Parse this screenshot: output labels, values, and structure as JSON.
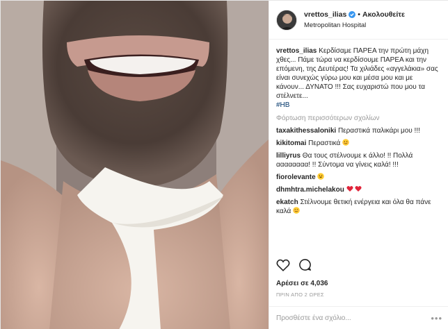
{
  "header": {
    "username": "vrettos_ilias",
    "follow_label": "Ακολουθείτε",
    "separator": "•",
    "location": "Metropolitan Hospital"
  },
  "caption": {
    "username": "vrettos_ilias",
    "text": "Κερδίσαμε ΠΑΡΕΑ την πρώτη μάχη χθες... Πάμε τώρα να κερδίσουμε ΠΑΡΕΑ και την επόμενη, της Δευτέρας! Τα χιλιάδες «αγγελάκια» σας είναι συνεχώς γύρω μου και μέσα μου και με κάνουν... ΔΥΝΑΤΟ !!! Σας ευχαριστώ που μου τα στέλνετε...",
    "hashtag": "#HB"
  },
  "load_more": "Φόρτωση περισσότερων σχολίων",
  "comments": [
    {
      "username": "taxakithessaloniki",
      "text": "Περαστικά παλικάρι μου !!!"
    },
    {
      "username": "kikitomai",
      "text": "Περαστικά"
    },
    {
      "username": "lilliyrus",
      "text": "Θα τους στέλνουμε κ άλλο! !! Πολλά αααααααα! !! Σύντομα να γίνεις καλά! !!!"
    },
    {
      "username": "fiorolevante",
      "text": ""
    },
    {
      "username": "dhmhtra.michelakou",
      "text": ""
    },
    {
      "username": "ekatch",
      "text": "Στέλνουμε θετική ενέργεια και όλα θα πάνε καλά"
    }
  ],
  "likes": "Αρέσει σε 4,036",
  "timestamp": "ΠΡΙΝ ΑΠΟ 2 ΩΡΕΣ",
  "add_comment": {
    "placeholder": "Προσθέστε ένα σχόλιο..."
  },
  "more_label": "•••",
  "colors": {
    "text": "#262626",
    "muted": "#999999",
    "hashtag": "#003569",
    "verified": "#3897f0",
    "heart": "#ed4956"
  }
}
